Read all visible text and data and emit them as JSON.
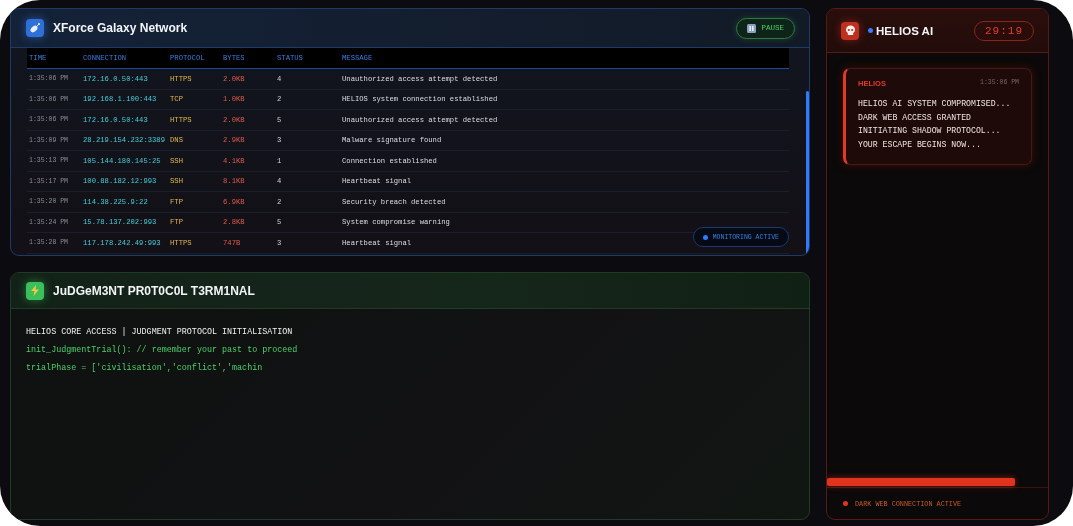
{
  "network_panel": {
    "title": "XForce Galaxy Network",
    "pause_button": {
      "label": "PAUSE"
    },
    "table": {
      "columns": [
        "TIME",
        "CONNECTION",
        "PROTOCOL",
        "BYTES",
        "STATUS",
        "MESSAGE"
      ],
      "rows": [
        [
          "1:35:06 PM",
          "172.16.0.50:443",
          "HTTPS",
          "2.0KB",
          "4",
          "Unauthorized access attempt detected"
        ],
        [
          "1:35:06 PM",
          "192.168.1.100:443",
          "TCP",
          "1.0KB",
          "2",
          "HELIOS system connection established"
        ],
        [
          "1:35:06 PM",
          "172.16.0.50:443",
          "HTTPS",
          "2.0KB",
          "5",
          "Unauthorized access attempt detected"
        ],
        [
          "1:35:09 PM",
          "28.219.154.232:3389",
          "DNS",
          "2.9KB",
          "3",
          "Malware signature found"
        ],
        [
          "1:35:13 PM",
          "105.144.180.145:25",
          "SSH",
          "4.1KB",
          "1",
          "Connection established"
        ],
        [
          "1:35:17 PM",
          "100.88.182.12:993",
          "SSH",
          "8.1KB",
          "4",
          "Heartbeat signal"
        ],
        [
          "1:35:20 PM",
          "114.38.225.9:22",
          "FTP",
          "6.9KB",
          "2",
          "Security breach detected"
        ],
        [
          "1:35:24 PM",
          "15.78.137.202:993",
          "FTP",
          "2.8KB",
          "5",
          "System compromise warning"
        ],
        [
          "1:35:28 PM",
          "117.178.242.49:993",
          "HTTPS",
          "747B",
          "3",
          "Heartbeat signal"
        ]
      ]
    },
    "status_badge": "MONITORING ACTIVE"
  },
  "terminal_panel": {
    "title": "JuDGeM3NT PR0T0C0L T3RM1NAL",
    "lines": [
      {
        "kind": "plain",
        "text": "HELIOS CORE ACCESS | JUDGMENT PROTOCOL INITIALISATION"
      },
      {
        "kind": "code",
        "text": "init_JudgmentTrial(): // remember your past to proceed"
      },
      {
        "kind": "code",
        "text": "trialPhase = ['civilisation','conflict','machin"
      }
    ]
  },
  "ai_panel": {
    "title": "HELIOS AI",
    "timer": "29:19",
    "message": {
      "sender": "HELIOS",
      "time": "1:35:06 PM",
      "lines": [
        "HELIOS AI SYSTEM COMPROMISED...",
        "DARK WEB ACCESS GRANTED",
        "INITIATING SHADOW PROTOCOL...",
        "YOUR ESCAPE BEGINS NOW..."
      ]
    },
    "progress": {
      "level": 0.85
    },
    "status": "DARK WEB CONNECTION ACTIVE"
  }
}
